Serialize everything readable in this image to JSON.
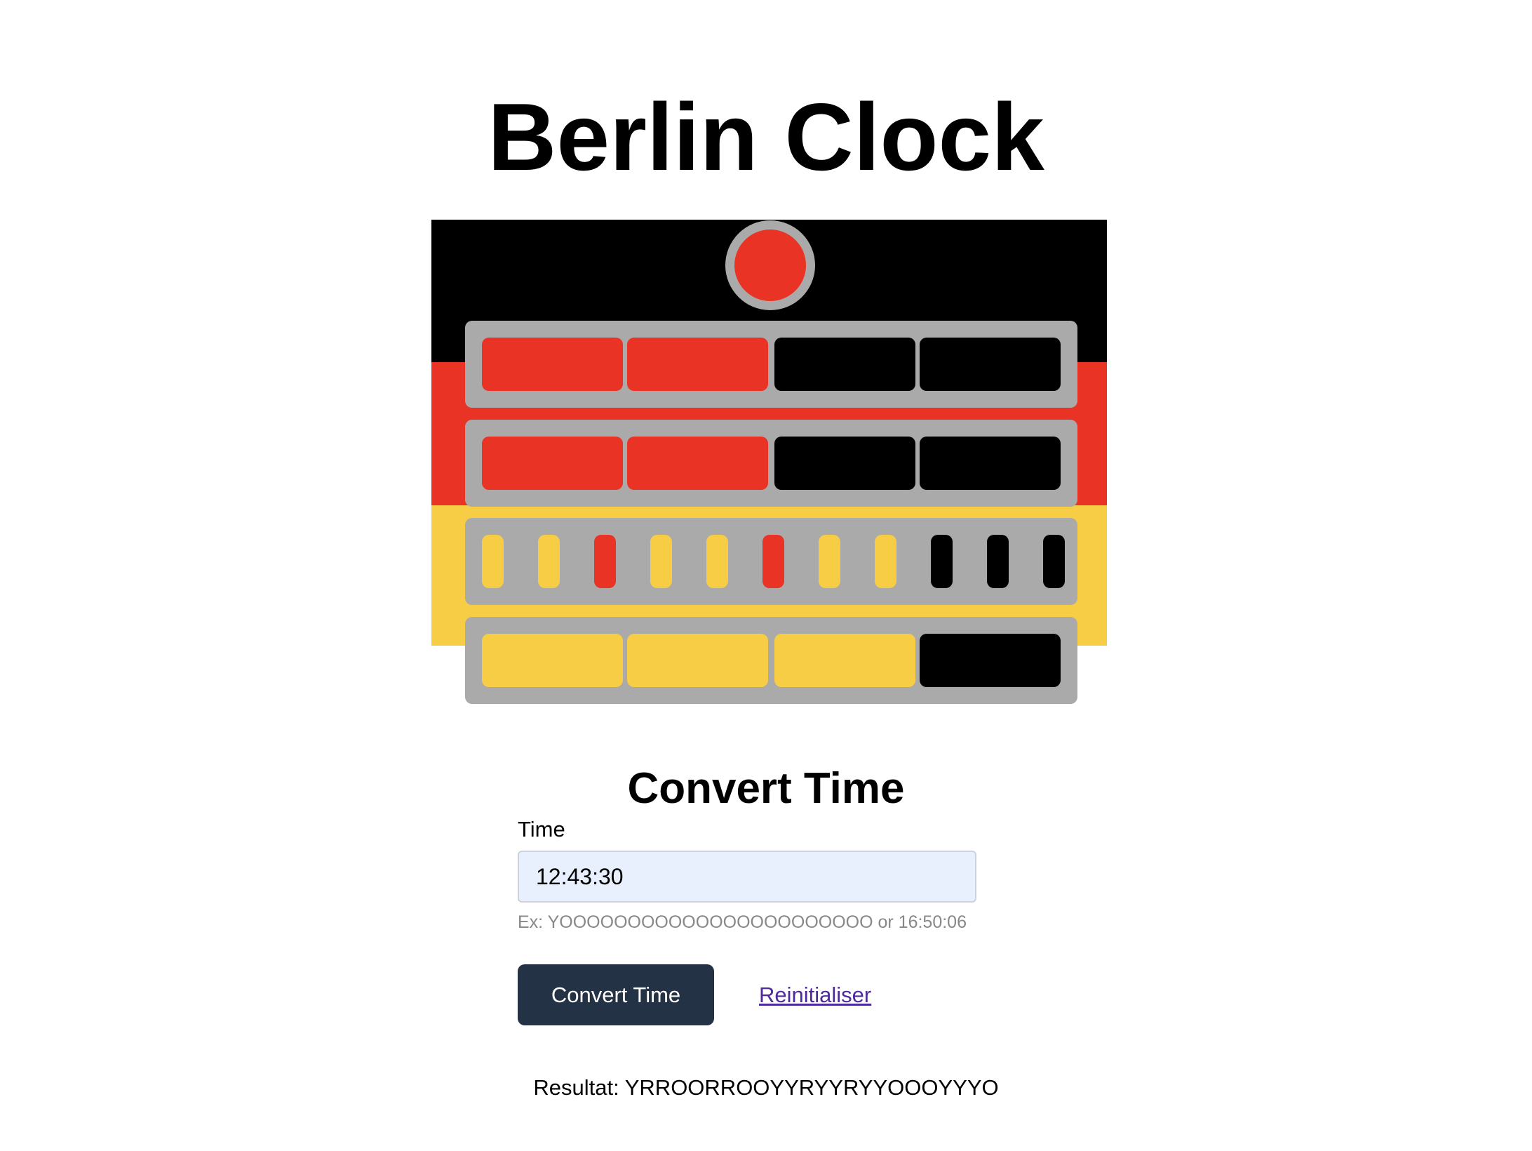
{
  "page": {
    "title": "Berlin Clock",
    "subtitle": "Convert Time"
  },
  "clock": {
    "seconds_lamp": "R",
    "rows": [
      [
        "R",
        "R",
        "O",
        "O"
      ],
      [
        "R",
        "R",
        "O",
        "O"
      ],
      [
        "Y",
        "Y",
        "R",
        "Y",
        "Y",
        "R",
        "Y",
        "Y",
        "O",
        "O",
        "O"
      ],
      [
        "Y",
        "Y",
        "Y",
        "O"
      ]
    ],
    "colors": {
      "red": "#e93325",
      "yellow": "#f6cd45",
      "off": "#000000",
      "frame": "#aaaaab"
    }
  },
  "flag_colors": [
    "#000000",
    "#e93325",
    "#f6cd45"
  ],
  "form": {
    "label": "Time",
    "value": "12:43:30",
    "hint": "Ex: YOOOOOOOOOOOOOOOOOOOOOOO or 16:50:06",
    "convert_label": "Convert Time",
    "reset_label": "Reinitialiser"
  },
  "result": {
    "text": "Resultat: YRROORROOYYRYYRYYOOOYYYO"
  }
}
